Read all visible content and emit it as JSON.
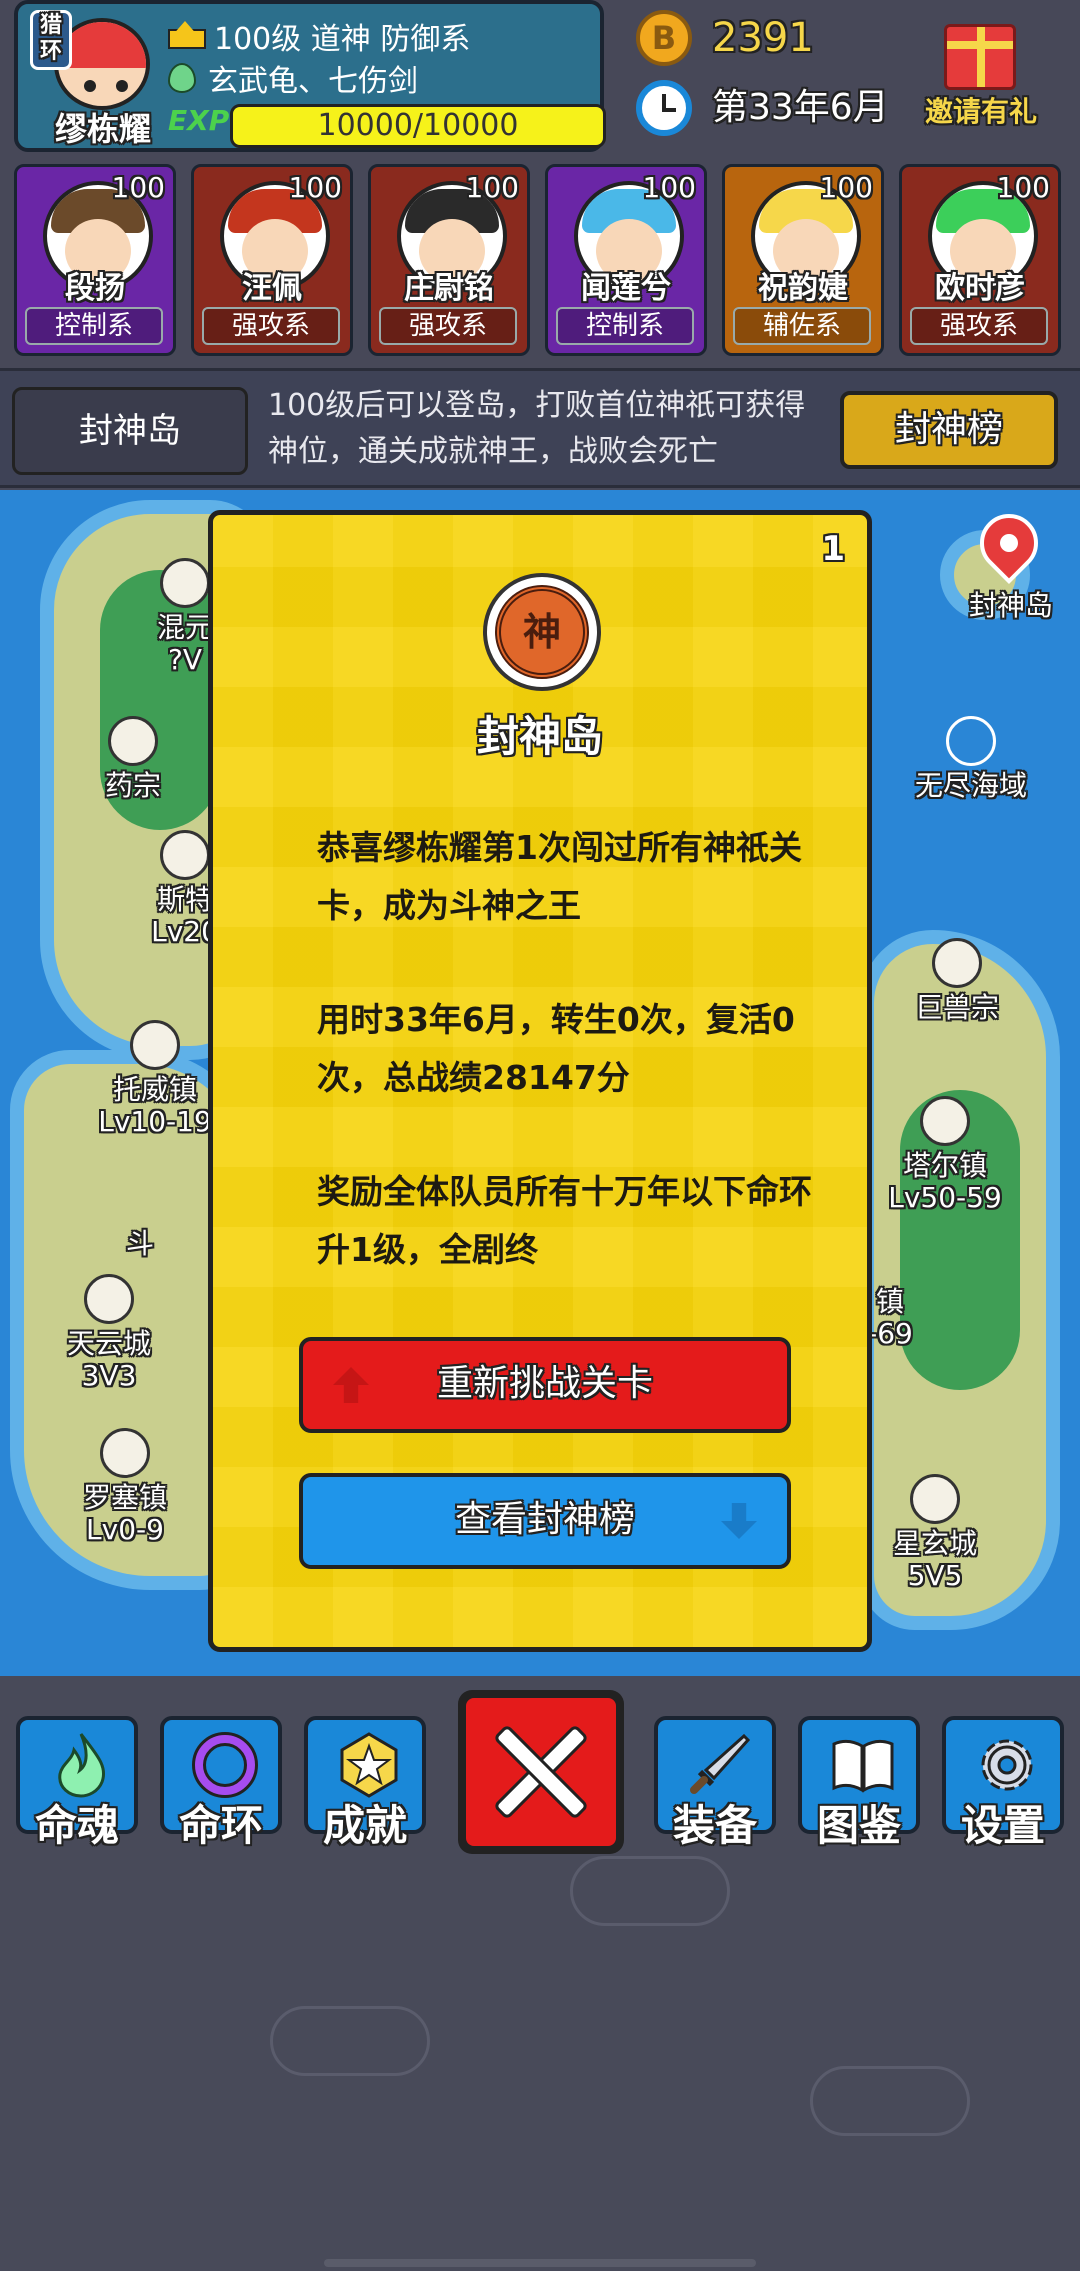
{
  "player": {
    "hunt_badge": "猎环",
    "name": "缪栋耀",
    "level_line": "100级 道神 防御系",
    "soul_line": "玄武龟、七伤剑",
    "exp_label": "EXP",
    "exp_text": "10000/10000",
    "exp_fraction": 1.0
  },
  "resources": {
    "coins": "2391",
    "date": "第33年6月",
    "gift_label": "邀请有礼"
  },
  "team": [
    {
      "level": "100",
      "name": "段扬",
      "type": "控制系",
      "hair": "#6b4a2a"
    },
    {
      "level": "100",
      "name": "汪佩",
      "type": "强攻系",
      "hair": "#c4361e"
    },
    {
      "level": "100",
      "name": "庄尉铭",
      "type": "强攻系",
      "hair": "#2a2a2a"
    },
    {
      "level": "100",
      "name": "闻莲兮",
      "type": "控制系",
      "hair": "#4ab8e8"
    },
    {
      "level": "100",
      "name": "祝韵婕",
      "type": "辅佐系",
      "hair": "#f6d74a"
    },
    {
      "level": "100",
      "name": "欧时彦",
      "type": "强攻系",
      "hair": "#3ccf5a"
    }
  ],
  "island_bar": {
    "name": "封神岛",
    "description": "100级后可以登岛，打败首位神祇可获得神位，通关成就神王，战败会死亡",
    "rank_button": "封神榜"
  },
  "map": {
    "locations": [
      {
        "name": "混元",
        "sub": "?V"
      },
      {
        "name": "药宗",
        "sub": ""
      },
      {
        "name": "斯特",
        "sub": "Lv20"
      },
      {
        "name": "托威镇",
        "sub": "Lv10-19"
      },
      {
        "name": "斗",
        "sub": ""
      },
      {
        "name": "天云城",
        "sub": "3V3"
      },
      {
        "name": "罗塞镇",
        "sub": "Lv0-9"
      },
      {
        "name": "封神岛",
        "sub": ""
      },
      {
        "name": "无尽海域",
        "sub": ""
      },
      {
        "name": "巨兽宗",
        "sub": ""
      },
      {
        "name": "塔尔镇",
        "sub": "Lv50-59"
      },
      {
        "name": "镇",
        "sub": "-69"
      },
      {
        "name": "星玄城",
        "sub": "5V5"
      }
    ]
  },
  "modal": {
    "count": "1",
    "emblem": "神",
    "title": "封神岛",
    "paragraph1": "恭喜缪栋耀第1次闯过所有神祇关卡，成为斗神之王",
    "paragraph2": "用时33年6月，转生0次，复活0次，总战绩28147分",
    "paragraph3": "奖励全体队员所有十万年以下命环升1级，全剧终",
    "retry_button": "重新挑战关卡",
    "view_rank_button": "查看封神榜"
  },
  "nav": {
    "soul": "命魂",
    "ring": "命环",
    "achievement": "成就",
    "equipment": "装备",
    "codex": "图鉴",
    "settings": "设置"
  }
}
